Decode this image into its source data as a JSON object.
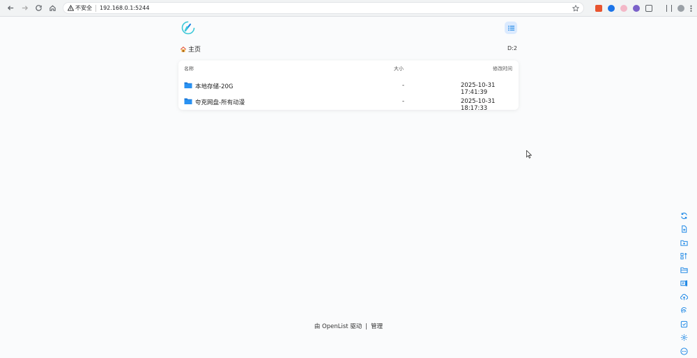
{
  "browser": {
    "security_label": "不安全",
    "url": "192.168.0.1:5244"
  },
  "breadcrumb": {
    "home_label": "主页"
  },
  "readme_label": "D:2",
  "table": {
    "headers": {
      "name": "名称",
      "size": "大小",
      "modified": "修改时间"
    },
    "rows": [
      {
        "name": "本地存储-20G",
        "size": "-",
        "modified": "2025-10-31 17:41:39"
      },
      {
        "name": "夸克网盘-所有动漫",
        "size": "-",
        "modified": "2025-10-31 18:17:33"
      }
    ]
  },
  "footer": {
    "powered_by": "由 OpenList 驱动",
    "separator": "|",
    "manage": "管理"
  },
  "colors": {
    "accent": "#1e88e5",
    "folder": "#1f8cf0",
    "logo": "#3cc8d8"
  },
  "toolbar_icons": [
    "refresh-icon",
    "new-file-icon",
    "new-folder-icon",
    "sort-icon",
    "folder-open-icon",
    "offline-download-icon",
    "upload-icon",
    "fingerprint-icon",
    "select-icon",
    "settings-icon",
    "more-icon"
  ]
}
